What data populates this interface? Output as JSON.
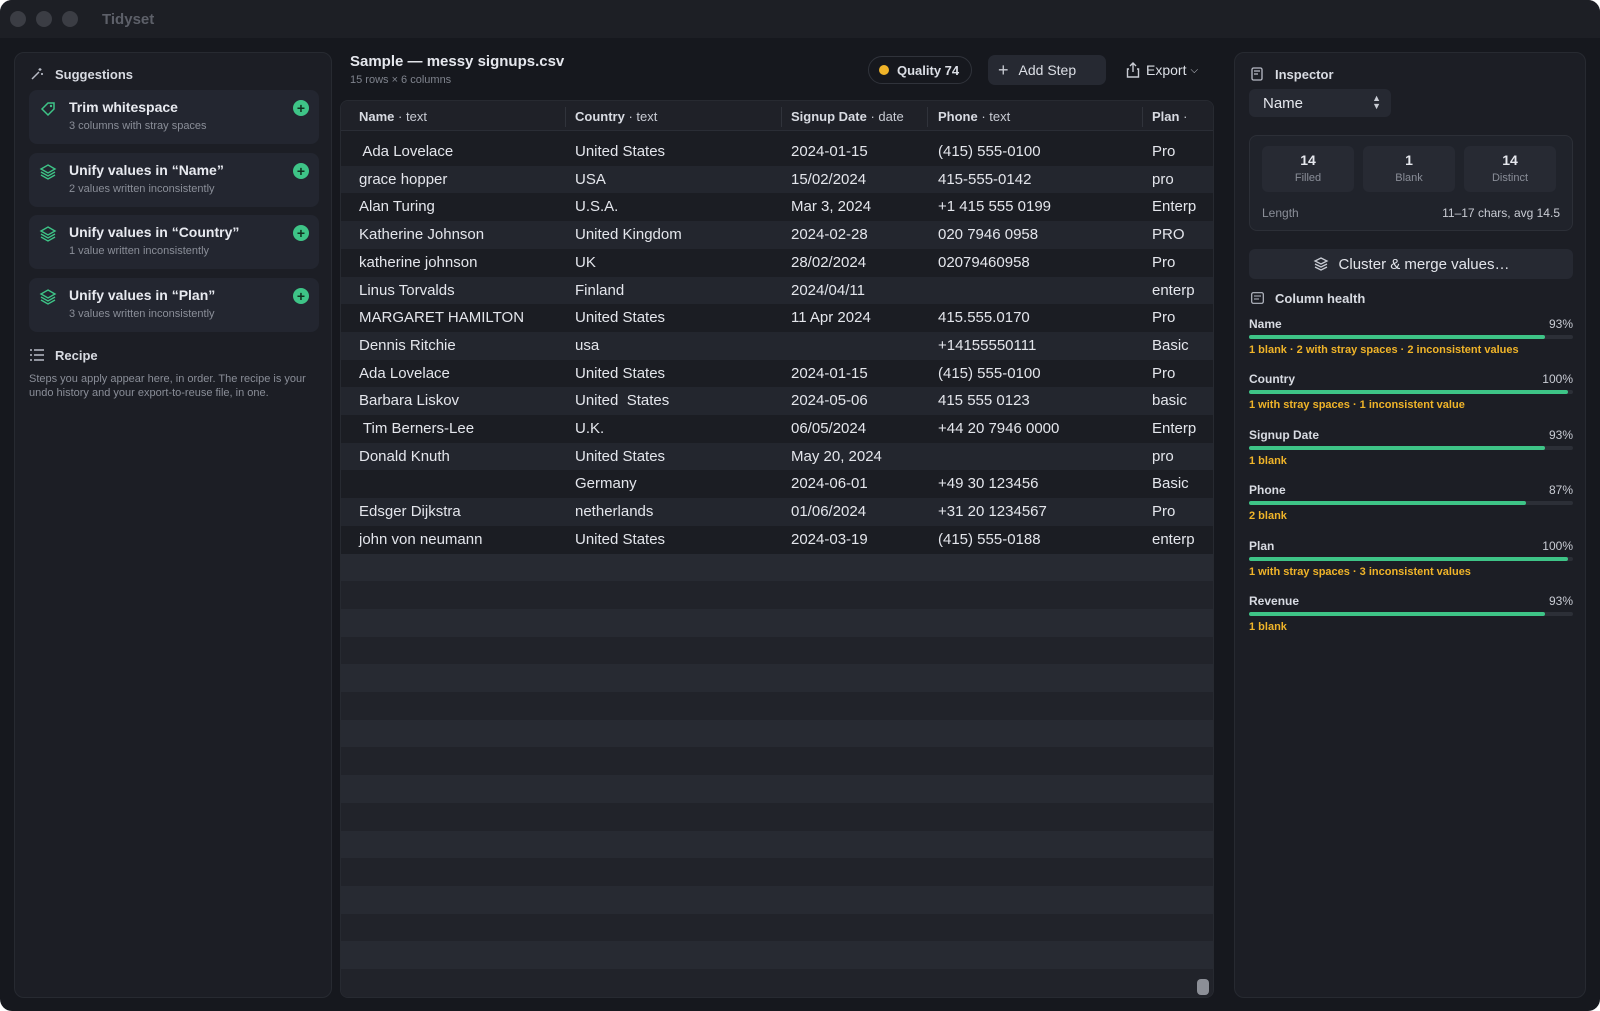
{
  "app": {
    "title": "Tidyset"
  },
  "suggestions": {
    "heading": "Suggestions",
    "items": [
      {
        "title": "Trim whitespace",
        "subtitle": "3 columns with stray spaces",
        "icon": "tag-icon"
      },
      {
        "title": "Unify values in “Name”",
        "subtitle": "2 values written inconsistently",
        "icon": "layers-icon"
      },
      {
        "title": "Unify values in “Country”",
        "subtitle": "1 value written inconsistently",
        "icon": "layers-icon"
      },
      {
        "title": "Unify values in “Plan”",
        "subtitle": "3 values written inconsistently",
        "icon": "layers-icon"
      }
    ]
  },
  "recipe": {
    "heading": "Recipe",
    "text": "Steps you apply appear here, in order. The recipe is your undo history and your export-to-reuse file, in one."
  },
  "file": {
    "title": "Sample — messy signups.csv",
    "subtitle": "15 rows × 6 columns",
    "quality_label": "Quality 74",
    "add_step_label": "Add Step",
    "export_label": "Export"
  },
  "table": {
    "columns": [
      {
        "name": "Name",
        "type": "text"
      },
      {
        "name": "Country",
        "type": "text"
      },
      {
        "name": "Signup Date",
        "type": "date"
      },
      {
        "name": "Phone",
        "type": "text"
      },
      {
        "name": "Plan",
        "type": ""
      }
    ],
    "rows": [
      [
        " Ada Lovelace",
        "United States",
        "2024-01-15",
        "(415) 555-0100",
        "Pro"
      ],
      [
        "grace hopper",
        "USA",
        "15/02/2024",
        "415-555-0142",
        "pro"
      ],
      [
        "Alan Turing",
        "U.S.A.",
        "Mar 3, 2024",
        "+1 415 555 0199",
        "Enterp"
      ],
      [
        "Katherine Johnson",
        "United Kingdom",
        "2024-02-28",
        "020 7946 0958",
        "PRO"
      ],
      [
        "katherine johnson",
        "UK",
        "28/02/2024",
        "02079460958",
        "Pro"
      ],
      [
        "Linus Torvalds",
        "Finland",
        "2024/04/11",
        "",
        "enterp"
      ],
      [
        "MARGARET HAMILTON",
        "United States",
        "11 Apr 2024",
        "415.555.0170",
        "Pro"
      ],
      [
        "Dennis Ritchie",
        "usa",
        "",
        "+14155550111",
        "Basic"
      ],
      [
        "Ada Lovelace",
        "United States",
        "2024-01-15",
        "(415) 555-0100",
        "Pro"
      ],
      [
        "Barbara Liskov",
        "United  States",
        "2024-05-06",
        "415 555 0123",
        "basic"
      ],
      [
        " Tim Berners-Lee",
        "U.K.",
        "06/05/2024",
        "+44 20 7946 0000",
        "Enterp"
      ],
      [
        "Donald Knuth",
        "United States",
        "May 20, 2024",
        "",
        "pro"
      ],
      [
        "",
        "Germany",
        "2024-06-01",
        "+49 30 123456",
        "Basic"
      ],
      [
        "Edsger Dijkstra",
        "netherlands",
        "01/06/2024",
        "+31 20 1234567",
        "Pro"
      ],
      [
        "john von neumann",
        "United States",
        "2024-03-19",
        "(415) 555-0188",
        "enterp"
      ]
    ]
  },
  "inspector": {
    "heading": "Inspector",
    "selected_column": "Name",
    "stats": [
      {
        "value": "14",
        "label": "Filled"
      },
      {
        "value": "1",
        "label": "Blank"
      },
      {
        "value": "14",
        "label": "Distinct"
      }
    ],
    "length_label": "Length",
    "length_value": "11–17 chars, avg 14.5",
    "cluster_button": "Cluster & merge values…",
    "health_heading": "Column health",
    "health": [
      {
        "name": "Name",
        "percent_label": "93%",
        "fill": 0.93,
        "note": "1 blank · 2 with stray spaces · 2 inconsistent values"
      },
      {
        "name": "Country",
        "percent_label": "100%",
        "fill": 1.0,
        "note": "1 with stray spaces · 1 inconsistent value"
      },
      {
        "name": "Signup Date",
        "percent_label": "93%",
        "fill": 0.93,
        "note": "1 blank"
      },
      {
        "name": "Phone",
        "percent_label": "87%",
        "fill": 0.87,
        "note": "2 blank"
      },
      {
        "name": "Plan",
        "percent_label": "100%",
        "fill": 1.0,
        "note": "1 with stray spaces · 3 inconsistent values"
      },
      {
        "name": "Revenue",
        "percent_label": "93%",
        "fill": 0.93,
        "note": "1 blank"
      }
    ]
  },
  "colors": {
    "accent_green": "#3ec487",
    "warning_amber": "#f0b429"
  }
}
